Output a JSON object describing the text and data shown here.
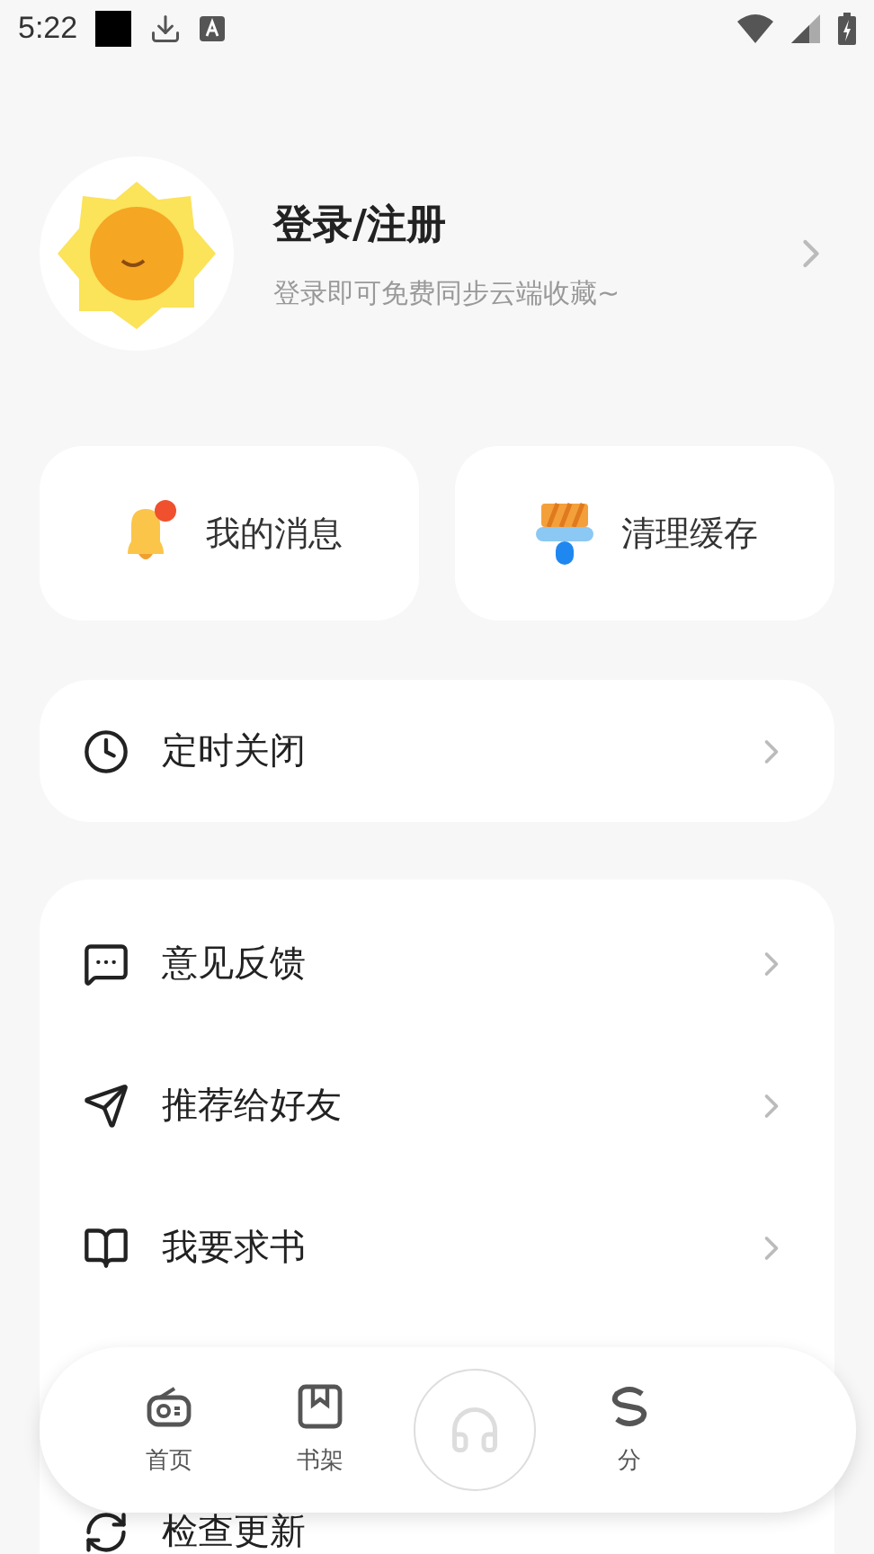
{
  "status_bar": {
    "time": "5:22"
  },
  "profile": {
    "title": "登录/注册",
    "subtitle": "登录即可免费同步云端收藏~"
  },
  "quick_actions": [
    {
      "kind": "bell",
      "label": "我的消息",
      "badge": true
    },
    {
      "kind": "brush",
      "label": "清理缓存"
    }
  ],
  "timer": {
    "label": "定时关闭"
  },
  "menu": [
    {
      "kind": "feedback",
      "label": "意见反馈"
    },
    {
      "kind": "share",
      "label": "推荐给好友"
    },
    {
      "kind": "book",
      "label": "我要求书"
    },
    {
      "kind": "update",
      "label": "检查更新"
    }
  ],
  "bottom_nav": [
    {
      "kind": "radio",
      "label": "首页"
    },
    {
      "kind": "shelf",
      "label": "书架"
    },
    {
      "kind": "player"
    },
    {
      "kind": "category",
      "label": "分"
    }
  ]
}
